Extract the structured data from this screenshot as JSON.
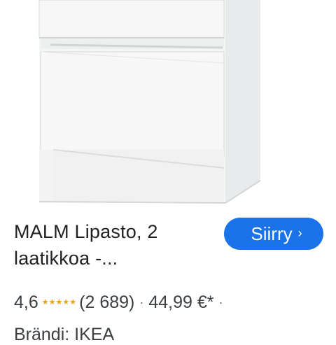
{
  "product": {
    "title": "MALM Lipasto, 2 laatikkoa -...",
    "rating": "4,6",
    "stars": 4.6,
    "review_count": "(2 689)",
    "price": "44,99 €*",
    "brand": "Brändi: IKEA"
  },
  "actions": {
    "go_label": "Siirry",
    "go_icon": "chevron-right-icon"
  },
  "colors": {
    "button": "#1a73e8",
    "star": "#e8a317"
  }
}
